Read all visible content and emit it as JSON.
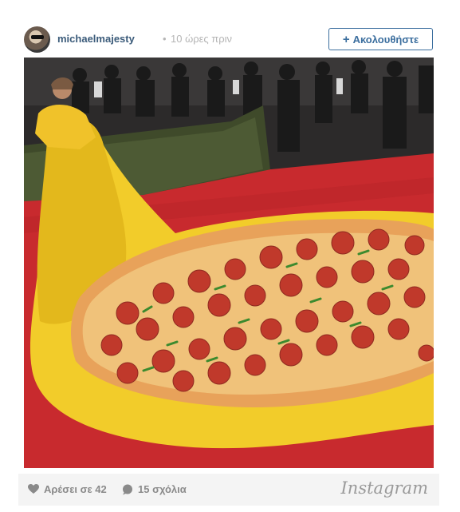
{
  "post": {
    "username": "michaelmajesty",
    "separator": "•",
    "time_ago": "10 ώρες πριν",
    "follow_label": "Ακολουθήστε",
    "follow_icon": "plus-icon"
  },
  "footer": {
    "likes_label": "Αρέσει σε 42",
    "likes_icon": "heart-icon",
    "comments_label": "15 σχόλια",
    "comments_icon": "comment-bubble-icon",
    "brand": "Instagram"
  },
  "colors": {
    "accent": "#3b6e9e",
    "username": "#3b5b7a",
    "muted": "#b5b5b5",
    "carpet": "#c82a2e",
    "gown": "#f2cc2a"
  }
}
